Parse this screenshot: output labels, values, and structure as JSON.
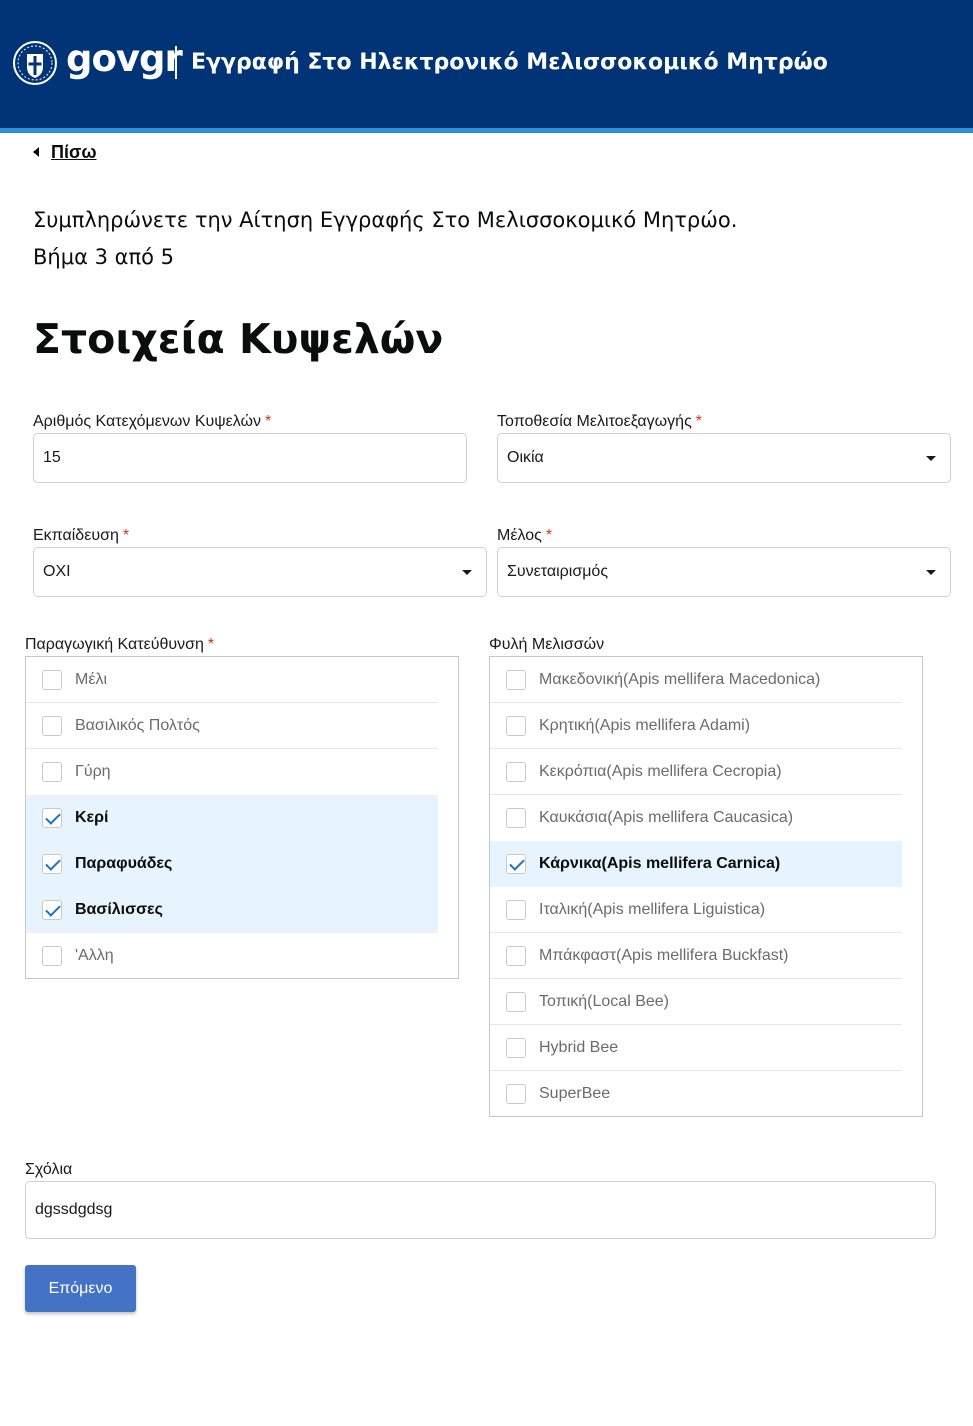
{
  "header": {
    "logo_prefix": "gov",
    "logo_suffix": "gr",
    "title": "Εγγραφή Στο Ηλεκτρονικό Μελισσοκομικό Μητρώο",
    "emblem_icon": "greek-coat-of-arms-icon",
    "background_color": "#003476",
    "stripe_color": "#2d8fd5"
  },
  "back": {
    "icon": "chevron-left-icon",
    "label": "Πίσω"
  },
  "intro": {
    "line1": "Συμπληρώνετε την Αίτηση Εγγραφής Στο Μελισσοκομικό Μητρώο.",
    "line2": "Βήμα 3 από 5"
  },
  "step": {
    "current": 3,
    "total": 5
  },
  "page_title": "Στοιχεία Κυψελών",
  "fields": {
    "hives": {
      "label": "Αριθμός Κατεχόμενων Κυψελών",
      "required_mark": "*",
      "value": "15"
    },
    "location": {
      "label": "Τοποθεσία Μελιτοεξαγωγής",
      "required_mark": "*",
      "value": "Οικία"
    },
    "training": {
      "label": "Εκπαίδευση",
      "required_mark": "*",
      "value": "ΟΧΙ"
    },
    "member": {
      "label": "Μέλος",
      "required_mark": "*",
      "value": "Συνεταιρισμός"
    }
  },
  "production": {
    "label": "Παραγωγική Κατεύθυνση",
    "required_mark": "*",
    "options": [
      {
        "label": "Μέλι",
        "checked": false
      },
      {
        "label": "Βασιλικός Πολτός",
        "checked": false
      },
      {
        "label": "Γύρη",
        "checked": false
      },
      {
        "label": "Κερί",
        "checked": true
      },
      {
        "label": "Παραφυάδες",
        "checked": true
      },
      {
        "label": "Βασίλισσες",
        "checked": true
      },
      {
        "label": "'Αλλη",
        "checked": false
      }
    ]
  },
  "breeds": {
    "label": "Φυλή Μελισσών",
    "options": [
      {
        "label": "Μακεδονική(Apis mellifera Macedonica)",
        "checked": false
      },
      {
        "label": "Κρητική(Apis mellifera Adami)",
        "checked": false
      },
      {
        "label": "Κεκρόπια(Apis mellifera Cecropia)",
        "checked": false
      },
      {
        "label": "Καυκάσια(Apis mellifera Caucasica)",
        "checked": false
      },
      {
        "label": "Κάρνικα(Apis mellifera Carnica)",
        "checked": true
      },
      {
        "label": "Ιταλική(Apis mellifera Liguistica)",
        "checked": false
      },
      {
        "label": "Μπάκφαστ(Apis mellifera Buckfast)",
        "checked": false
      },
      {
        "label": "Τοπική(Local Bee)",
        "checked": false
      },
      {
        "label": "Hybrid Bee",
        "checked": false
      },
      {
        "label": "SuperBee",
        "checked": false
      }
    ]
  },
  "comments": {
    "label": "Σχόλια",
    "value": "dgssdgdsg"
  },
  "next_button": {
    "label": "Επόμενο",
    "color": "#4472c4"
  },
  "colors": {
    "required": "#d4351c",
    "selected_row": "#e8f4fd",
    "checkmark": "#1b73c8"
  }
}
